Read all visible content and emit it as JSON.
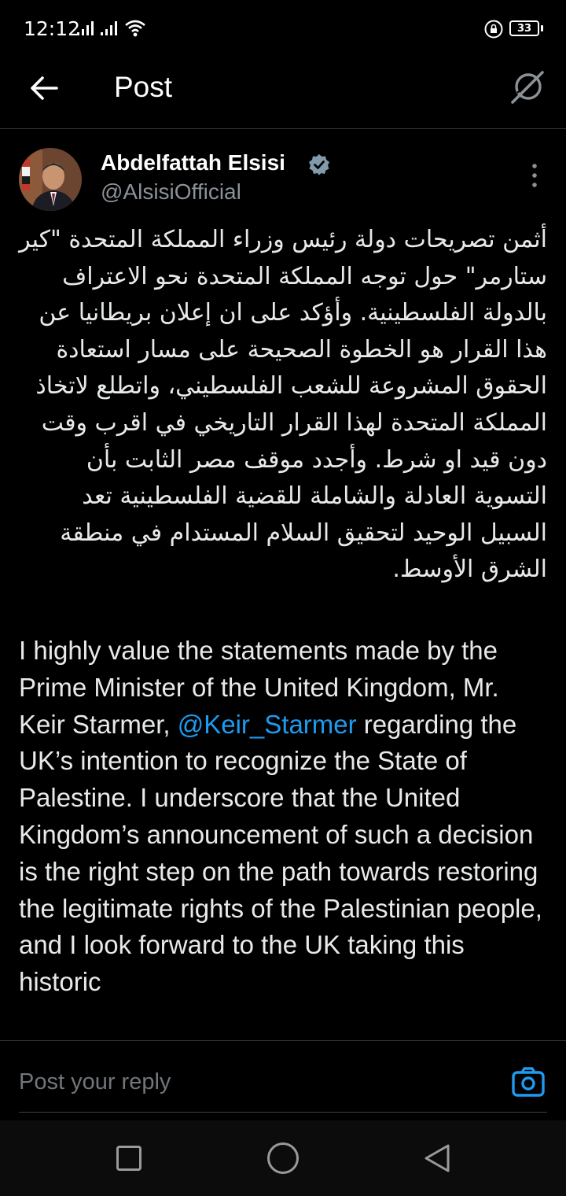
{
  "status_bar": {
    "time": "12:12",
    "battery": "33"
  },
  "header": {
    "title": "Post"
  },
  "post": {
    "author_name": "Abdelfattah Elsisi",
    "author_handle": "@AlsisiOfficial",
    "arabic_text": "أثمن تصريحات دولة رئيس وزراء المملكة المتحدة \"كير ستارمر\" حول توجه المملكة المتحدة نحو الاعتراف بالدولة الفلسطينية. وأؤكد على ان إعلان بريطانيا عن هذا القرار  هو الخطوة الصحيحة على مسار  استعادة الحقوق المشروعة للشعب الفلسطيني، واتطلع لاتخاذ المملكة المتحدة لهذا القرار التاريخي في اقرب وقت دون قيد او شرط. وأجدد موقف مصر الثابت بأن التسوية العادلة والشاملة للقضية الفلسطينية تعد السبيل الوحيد لتحقيق السلام المستدام في منطقة الشرق الأوسط.",
    "english_before": "I highly value the statements made by the Prime Minister of the United Kingdom, Mr. Keir Starmer, ",
    "english_mention": "@Keir_Starmer",
    "english_after": " regarding the UK’s intention to recognize the State of Palestine. I underscore that the United Kingdom’s announcement of such a decision is the right step on the path towards restoring the legitimate rights of the Palestinian people, and I look forward to the UK taking this historic"
  },
  "reply": {
    "placeholder": "Post your reply"
  },
  "colors": {
    "background": "#000000",
    "text": "#e7e9ea",
    "secondary_text": "#71767b",
    "link": "#1d9bf0",
    "verified_badge": "#829aab",
    "divider": "#2f3336"
  }
}
